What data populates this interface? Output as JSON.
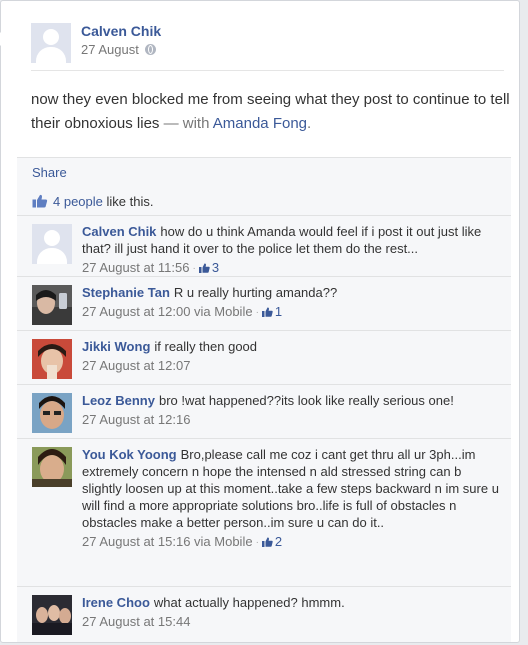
{
  "post": {
    "author": "Calven Chik",
    "time": "27 August",
    "text_main": "now they even blocked me from seeing what they post to continue to tell their obnoxious lies",
    "with_prefix": "— with",
    "tagged": "Amanda Fong",
    "tagged_suffix": "."
  },
  "actions": {
    "share": "Share"
  },
  "likes": {
    "count_text": "4 people",
    "suffix": "like this."
  },
  "comments": [
    {
      "name": "Calven Chik",
      "text": "how do u think Amanda would feel if i post it out just like that? ill just hand it over to the police let them do the rest...",
      "time": "27 August at 11:56",
      "likes": "3"
    },
    {
      "name": "Stephanie Tan",
      "text": "R u really hurting amanda??",
      "time": "27 August at 12:00 via Mobile",
      "likes": "1"
    },
    {
      "name": "Jikki Wong",
      "text": "if really then good",
      "time": "27 August at 12:07"
    },
    {
      "name": "Leoz Benny",
      "text": "bro !wat happened??its look like really serious one!",
      "time": "27 August at 12:16"
    },
    {
      "name": "You Kok Yoong",
      "text": "Bro,please call me coz i cant get thru all ur 3ph...im extremely concern n hope the intensed n ald stressed string can b slightly loosen up at this moment..take a few steps backward n im sure u will find a more appropriate solutions bro..life is full of obstacles n obstacles make a better person..im sure u can do it..",
      "time": "27 August at 15:16 via Mobile",
      "likes": "2"
    },
    {
      "name": "Irene Choo",
      "text": "what actually happened? hmmm.",
      "time": "27 August at 15:44"
    }
  ],
  "colors": {
    "link": "#3b5998",
    "meta": "#777777",
    "ufi_bg": "#f6f7f9"
  }
}
